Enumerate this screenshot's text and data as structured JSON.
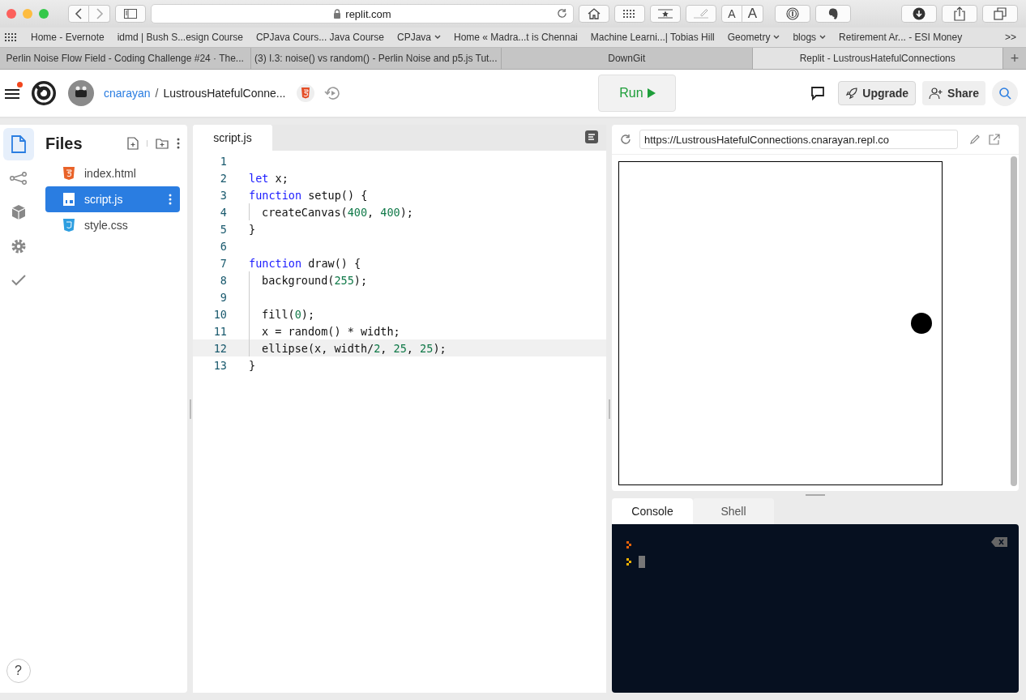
{
  "browser": {
    "address": "replit.com",
    "font_buttons": [
      "A",
      "A"
    ],
    "bookmarks": [
      {
        "label": "Home - Evernote",
        "has_menu": false
      },
      {
        "label": "idmd | Bush S...esign Course",
        "has_menu": false
      },
      {
        "label": "CPJava Cours... Java Course",
        "has_menu": false
      },
      {
        "label": "CPJava",
        "has_menu": true
      },
      {
        "label": "Home « Madra...t is Chennai",
        "has_menu": false
      },
      {
        "label": "Machine Learni...| Tobias Hill",
        "has_menu": false
      },
      {
        "label": "Geometry",
        "has_menu": true
      },
      {
        "label": "blogs",
        "has_menu": true
      },
      {
        "label": "Retirement Ar... - ESI Money",
        "has_menu": false
      }
    ],
    "more_bookmarks": ">>",
    "tabs": [
      {
        "title": "Perlin Noise Flow Field - Coding Challenge #24 · The...",
        "selected": false
      },
      {
        "title": "(3) I.3: noise() vs random() - Perlin Noise and p5.js Tut...",
        "selected": false
      },
      {
        "title": "DownGit",
        "selected": false
      },
      {
        "title": "Replit - LustrousHatefulConnections",
        "selected": true
      }
    ],
    "new_tab": "+"
  },
  "header": {
    "owner": "cnarayan",
    "separator": "/",
    "repl_name": "LustrousHatefulConne...",
    "notification": true,
    "run_label": "Run",
    "upgrade_label": "Upgrade",
    "share_label": "Share"
  },
  "sidebar": {
    "items": [
      {
        "kind": "files",
        "selected": true
      },
      {
        "kind": "git",
        "selected": false
      },
      {
        "kind": "packages",
        "selected": false
      },
      {
        "kind": "settings",
        "selected": false
      },
      {
        "kind": "check",
        "selected": false
      }
    ],
    "help": "?"
  },
  "files": {
    "title": "Files",
    "items": [
      {
        "name": "index.html",
        "kind": "html",
        "selected": false
      },
      {
        "name": "script.js",
        "kind": "js",
        "selected": true
      },
      {
        "name": "style.css",
        "kind": "css",
        "selected": false
      }
    ]
  },
  "editor": {
    "tab": "script.js",
    "lines": [
      {
        "number": "1",
        "indent": false,
        "current": false
      },
      {
        "number": "2",
        "indent": false,
        "current": false,
        "tokens": [
          {
            "text": "let",
            "kind": "keyword"
          },
          {
            "text": " x;",
            "kind": "plain"
          }
        ]
      },
      {
        "number": "3",
        "indent": false,
        "current": false,
        "tokens": [
          {
            "text": "function",
            "kind": "keyword"
          },
          {
            "text": " setup() {",
            "kind": "plain"
          }
        ]
      },
      {
        "number": "4",
        "indent": true,
        "current": false,
        "tokens": [
          {
            "text": "createCanvas(",
            "kind": "plain"
          },
          {
            "text": "400",
            "kind": "number"
          },
          {
            "text": ", ",
            "kind": "plain"
          },
          {
            "text": "400",
            "kind": "number"
          },
          {
            "text": ");",
            "kind": "plain"
          }
        ]
      },
      {
        "number": "5",
        "indent": false,
        "current": false,
        "tokens": [
          {
            "text": "}",
            "kind": "plain"
          }
        ]
      },
      {
        "number": "6",
        "indent": false,
        "current": false
      },
      {
        "number": "7",
        "indent": false,
        "current": false,
        "tokens": [
          {
            "text": "function",
            "kind": "keyword"
          },
          {
            "text": " draw() {",
            "kind": "plain"
          }
        ]
      },
      {
        "number": "8",
        "indent": true,
        "current": false,
        "tokens": [
          {
            "text": "background(",
            "kind": "plain"
          },
          {
            "text": "255",
            "kind": "number"
          },
          {
            "text": ");",
            "kind": "plain"
          }
        ]
      },
      {
        "number": "9",
        "indent": true,
        "current": false
      },
      {
        "number": "10",
        "indent": true,
        "current": false,
        "tokens": [
          {
            "text": "fill(",
            "kind": "plain"
          },
          {
            "text": "0",
            "kind": "number"
          },
          {
            "text": ");",
            "kind": "plain"
          }
        ]
      },
      {
        "number": "11",
        "indent": true,
        "current": false,
        "tokens": [
          {
            "text": "x = random() * width;",
            "kind": "plain"
          }
        ]
      },
      {
        "number": "12",
        "indent": true,
        "current": true,
        "tokens": [
          {
            "text": "ellipse(x, width/",
            "kind": "plain"
          },
          {
            "text": "2",
            "kind": "number"
          },
          {
            "text": ", ",
            "kind": "plain"
          },
          {
            "text": "25",
            "kind": "number"
          },
          {
            "text": ", ",
            "kind": "plain"
          },
          {
            "text": "25",
            "kind": "number"
          },
          {
            "text": ");",
            "kind": "plain"
          }
        ]
      },
      {
        "number": "13",
        "indent": false,
        "current": false,
        "tokens": [
          {
            "text": "}",
            "kind": "plain"
          }
        ]
      }
    ]
  },
  "webview": {
    "url": "https://LustrousHatefulConnections.cnarayan.repl.co"
  },
  "console": {
    "tabs": [
      {
        "label": "Console",
        "selected": true
      },
      {
        "label": "Shell",
        "selected": false
      }
    ],
    "prompts": [
      {
        "color": "#e8630a"
      },
      {
        "color": "#f5b400"
      }
    ]
  }
}
